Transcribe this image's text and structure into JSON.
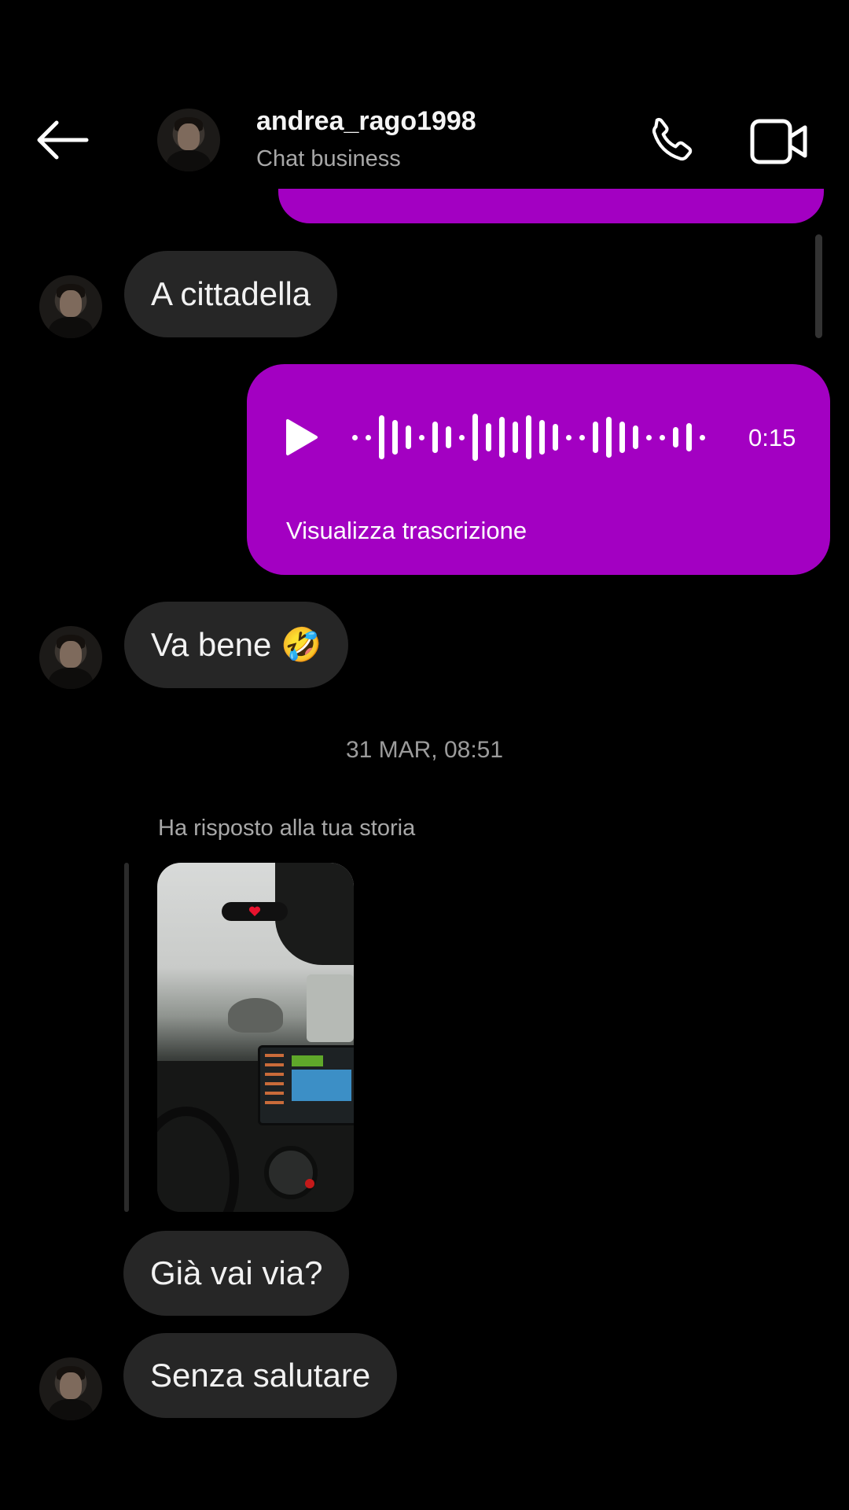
{
  "header": {
    "username": "andrea_rago1998",
    "subtitle": "Chat business",
    "back_icon": "arrow-left-icon",
    "call_icon": "phone-icon",
    "video_icon": "video-camera-icon"
  },
  "messages": [
    {
      "type": "received",
      "text": "A cittadella"
    },
    {
      "type": "voice",
      "duration": "0:15",
      "transcript_label": "Visualizza trascrizione"
    },
    {
      "type": "received",
      "text": "Va bene 🤣"
    },
    {
      "type": "timestamp",
      "text": "31 MAR, 08:51"
    },
    {
      "type": "story_reply",
      "label": "Ha risposto alla tua storia"
    },
    {
      "type": "received",
      "text": "Già vai via?"
    },
    {
      "type": "received",
      "text": "Senza salutare"
    }
  ],
  "colors": {
    "background": "#000000",
    "received_bubble": "#262626",
    "sent_bubble": "#a300c2"
  }
}
